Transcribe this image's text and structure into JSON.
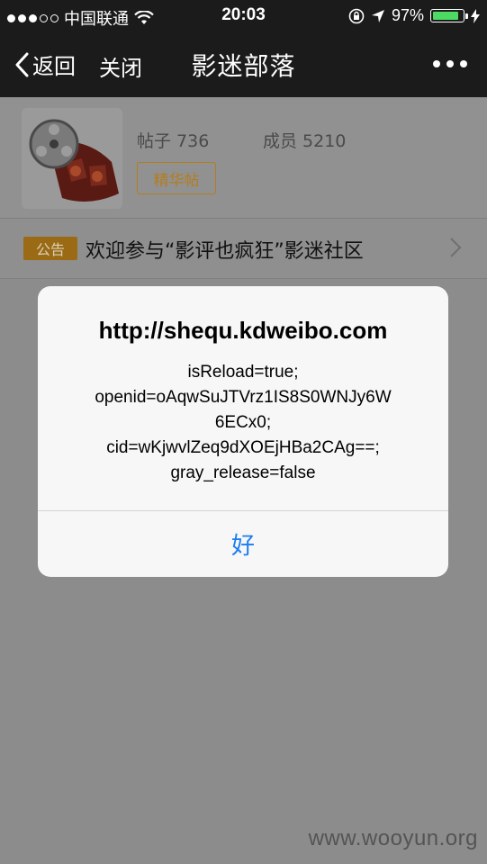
{
  "status_bar": {
    "carrier": "中国联通",
    "time": "20:03",
    "battery_percent": "97%",
    "signal_bars_filled": 3,
    "signal_bars_total": 5
  },
  "nav": {
    "back_label": "返回",
    "close_label": "关闭",
    "title": "影迷部落"
  },
  "community": {
    "posts_label": "帖子 736",
    "members_label": "成员 5210",
    "elite_button": "精华帖"
  },
  "notice": {
    "badge": "公告",
    "text": "欢迎参与“影评也疯狂”影迷社区"
  },
  "alert": {
    "title": "http://shequ.kdweibo.com",
    "message_lines": [
      "isReload=true;",
      "openid=oAqwSuJTVrz1IS8S0WNJy6W",
      "6ECx0;",
      "cid=wKjwvlZeq9dXOEjHBa2CAg==;",
      "gray_release=false"
    ],
    "ok_button": "好"
  },
  "watermark": "www.wooyun.org",
  "colors": {
    "accent_blue": "#1a7ef0",
    "badge_orange": "#9a6a14",
    "battery_green": "#4cd964"
  }
}
